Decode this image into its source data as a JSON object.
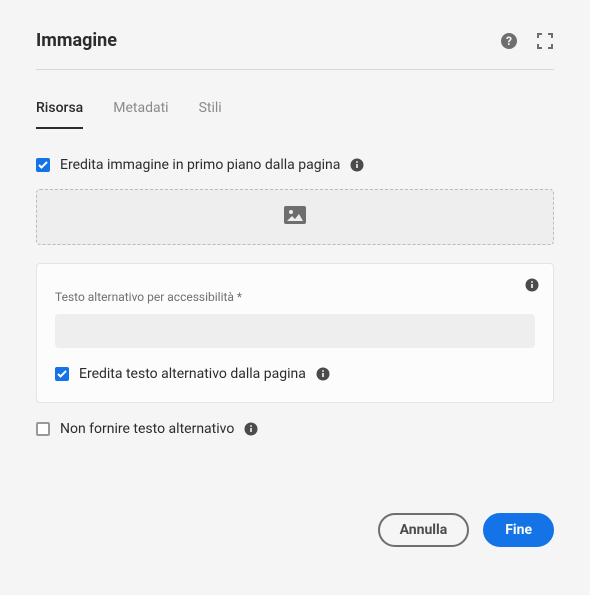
{
  "header": {
    "title": "Immagine",
    "helpIcon": "help-icon",
    "fullscreenIcon": "fullscreen-icon"
  },
  "tabs": [
    {
      "label": "Risorsa",
      "active": true
    },
    {
      "label": "Metadati",
      "active": false
    },
    {
      "label": "Stili",
      "active": false
    }
  ],
  "inheritImage": {
    "checked": true,
    "label": "Eredita immagine in primo piano dalla pagina"
  },
  "dropzone": {
    "icon": "image-icon"
  },
  "altPanel": {
    "fieldLabel": "Testo alternativo per accessibilità *",
    "fieldValue": "",
    "inheritAlt": {
      "checked": true,
      "label": "Eredita testo alternativo dalla pagina"
    }
  },
  "noAlt": {
    "checked": false,
    "label": "Non fornire testo alternativo"
  },
  "footer": {
    "cancel": "Annulla",
    "done": "Fine"
  }
}
